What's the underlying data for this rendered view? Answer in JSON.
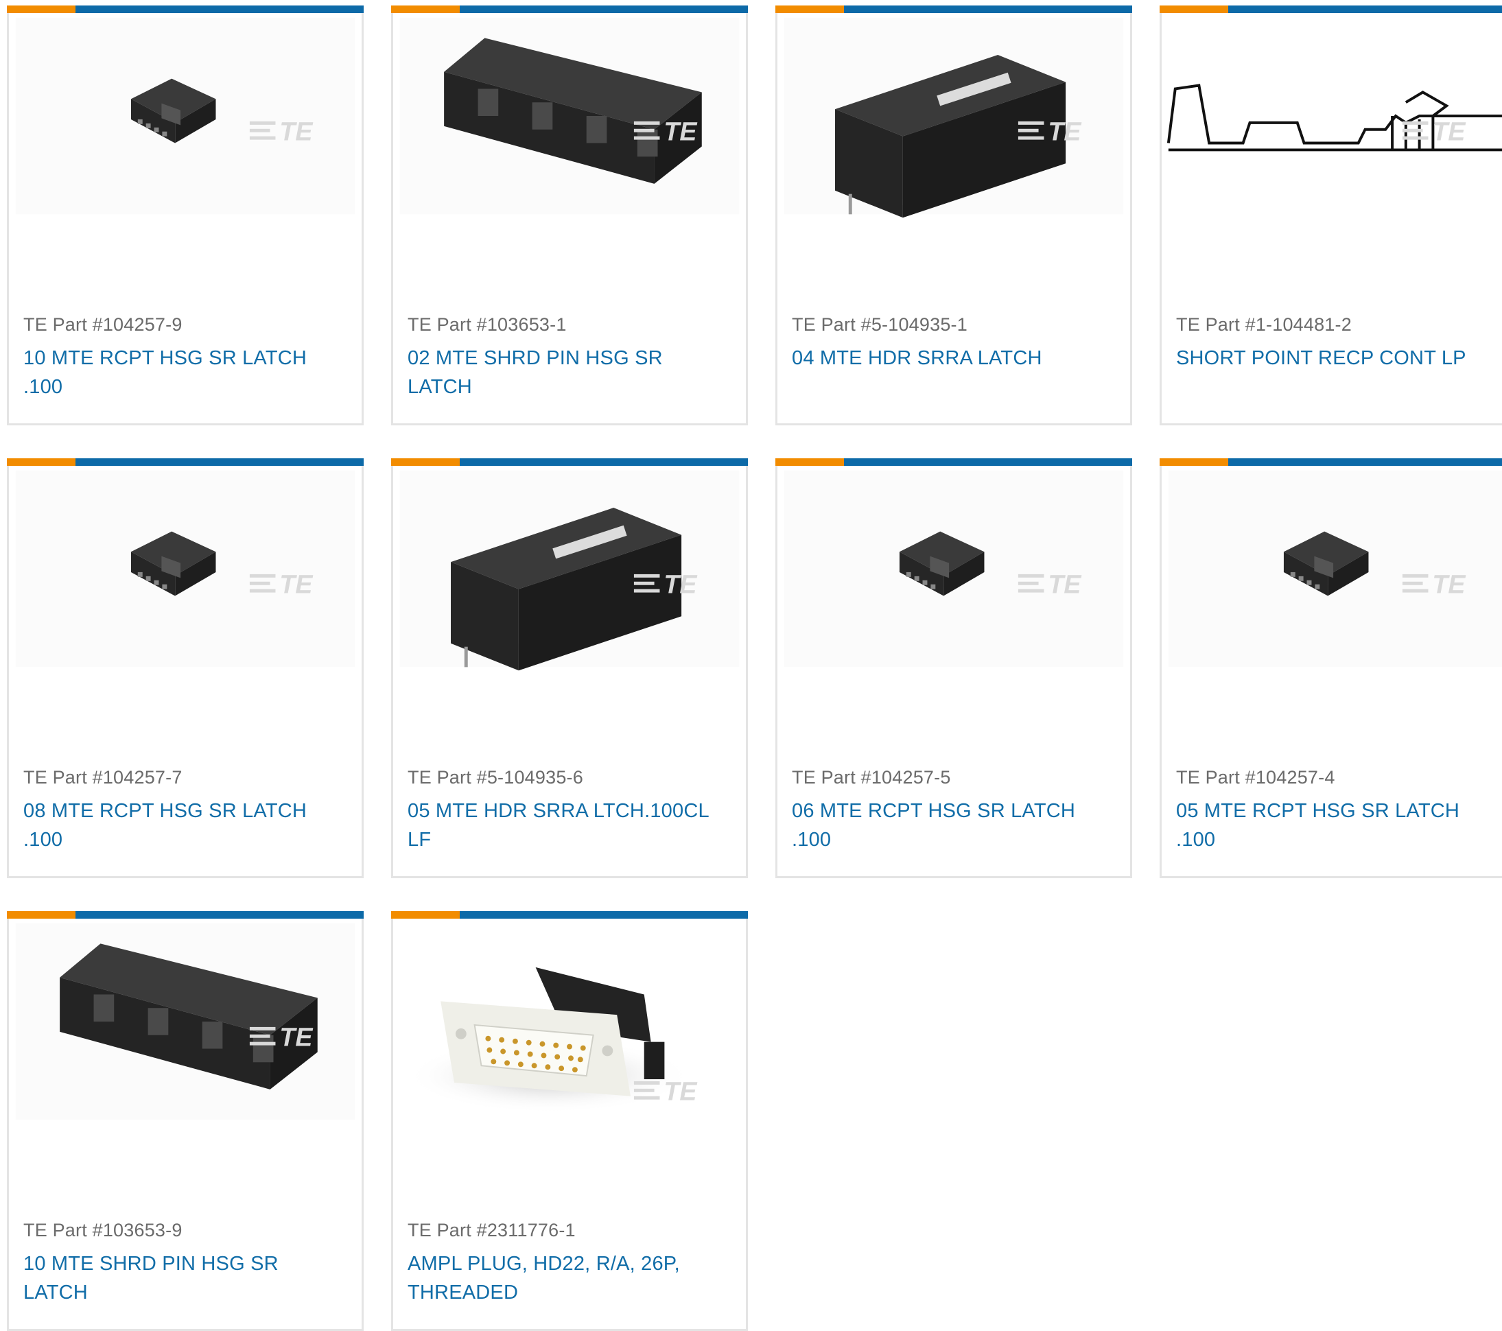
{
  "colors": {
    "accent_orange": "#f28c00",
    "accent_blue": "#0d6aa8",
    "link_blue": "#116da8",
    "muted_gray": "#6b6b6b",
    "card_border": "#e4e4e4"
  },
  "products": [
    {
      "part_label": "TE Part #104257-9",
      "description": "10 MTE RCPT HSG SR LATCH .100",
      "image": "small-receptacle-housing",
      "watermark": "TE"
    },
    {
      "part_label": "TE Part #103653-1",
      "description": "02 MTE SHRD PIN HSG SR LATCH",
      "image": "shrouded-pin-housing-array",
      "watermark": "TE"
    },
    {
      "part_label": "TE Part #5-104935-1",
      "description": "04 MTE HDR SRRA LATCH",
      "image": "right-angle-header",
      "watermark": "TE"
    },
    {
      "part_label": "TE Part #1-104481-2",
      "description": "SHORT POINT RECP CONT LP",
      "image": "contact-line-drawing",
      "watermark": "TE"
    },
    {
      "part_label": "TE Part #104257-7",
      "description": "08 MTE RCPT HSG SR LATCH .100",
      "image": "small-receptacle-housing",
      "watermark": "TE"
    },
    {
      "part_label": "TE Part #5-104935-6",
      "description": "05 MTE HDR SRRA LTCH.100CL LF",
      "image": "right-angle-header",
      "watermark": "TE"
    },
    {
      "part_label": "TE Part #104257-5",
      "description": "06 MTE RCPT HSG SR LATCH .100",
      "image": "small-receptacle-housing",
      "watermark": "TE"
    },
    {
      "part_label": "TE Part #104257-4",
      "description": "05 MTE RCPT HSG SR LATCH .100",
      "image": "small-receptacle-housing",
      "watermark": "TE"
    },
    {
      "part_label": "TE Part #103653-9",
      "description": "10 MTE SHRD PIN HSG SR LATCH",
      "image": "shrouded-pin-housing-array",
      "watermark": "TE"
    },
    {
      "part_label": "TE Part #2311776-1",
      "description": "AMPL PLUG, HD22, R/A, 26P, THREADED",
      "image": "d-sub-plug",
      "watermark": "TE"
    }
  ]
}
